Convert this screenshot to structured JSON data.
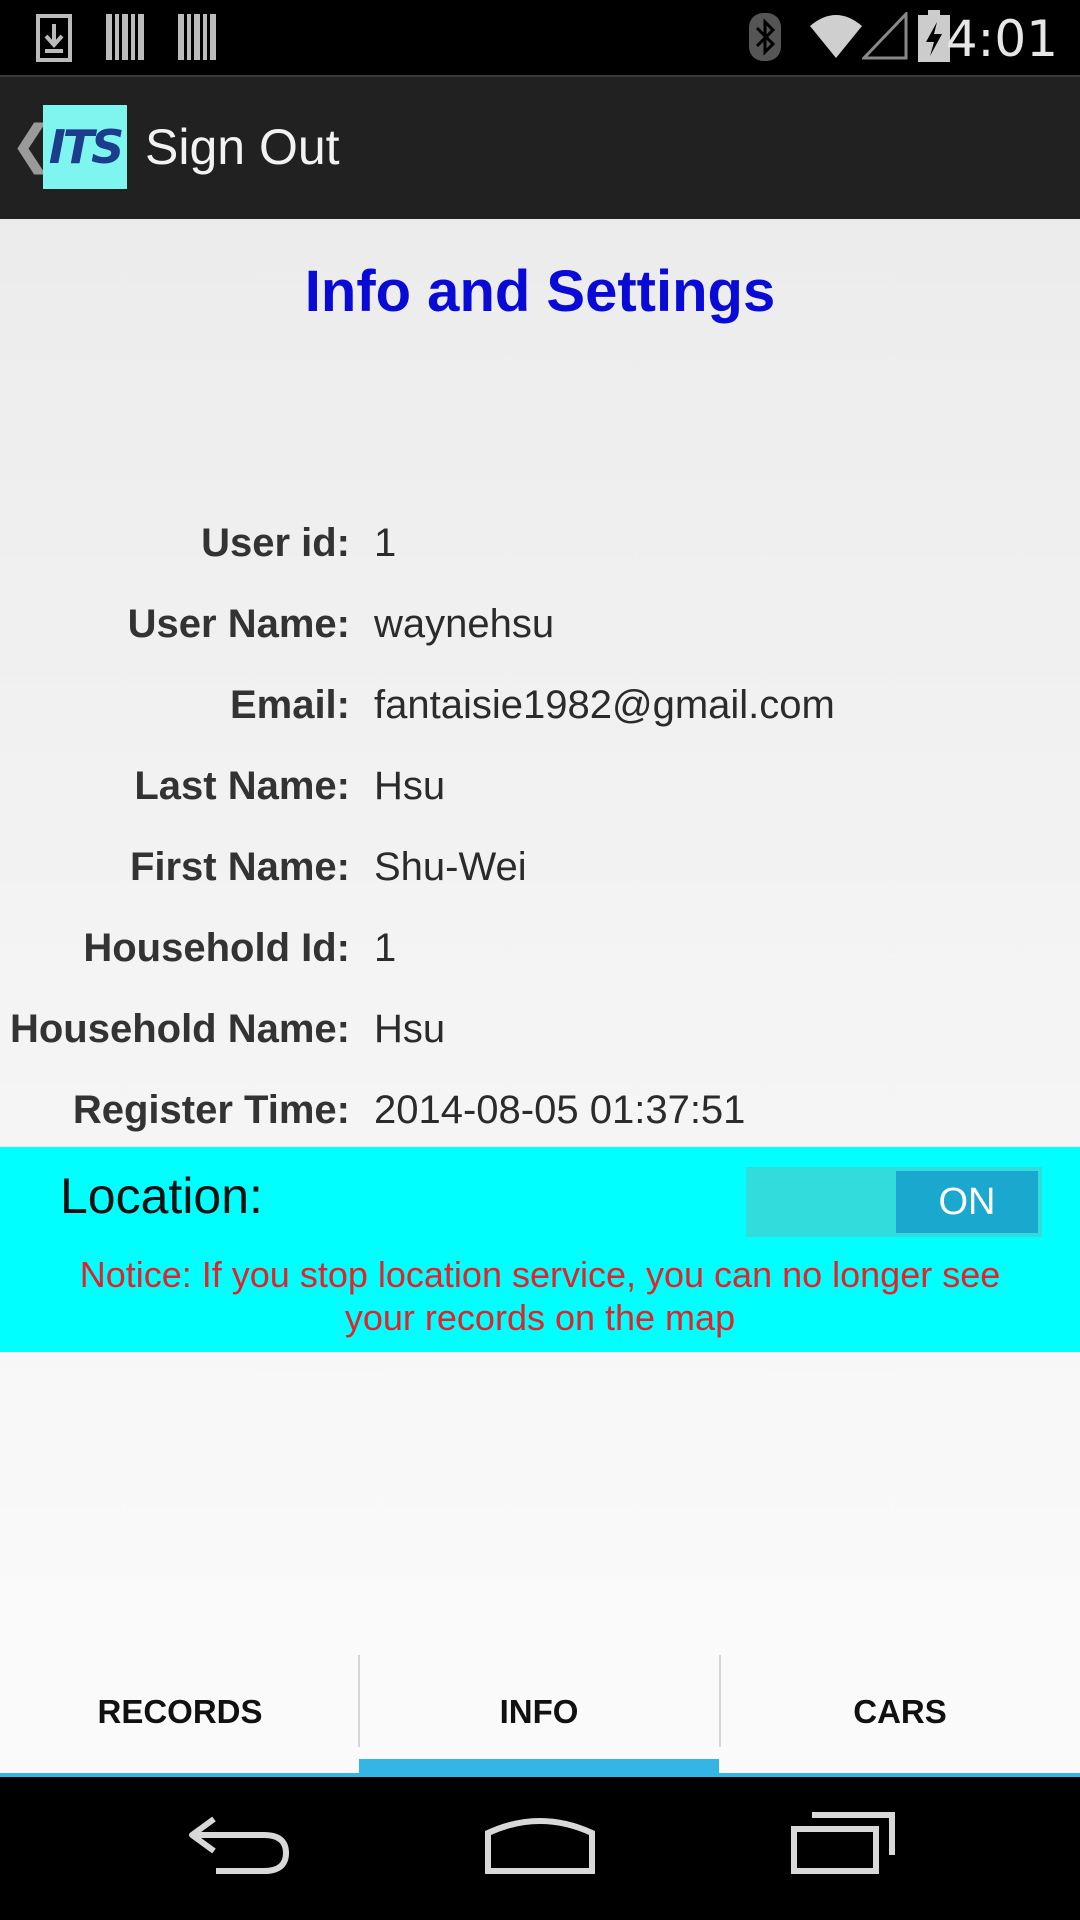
{
  "status_bar": {
    "time": "4:01",
    "icons": [
      "download-notification-icon",
      "barcode-icon",
      "barcode-icon",
      "bluetooth-icon",
      "wifi-icon",
      "cell-signal-icon",
      "battery-charging-icon"
    ]
  },
  "action_bar": {
    "back_glyph": "❮",
    "logo_text": "ITS",
    "title": "Sign Out"
  },
  "page": {
    "title": "Info and Settings",
    "fields": [
      {
        "label": "User id:",
        "value": "1"
      },
      {
        "label": "User Name:",
        "value": "waynehsu"
      },
      {
        "label": "Email:",
        "value": "fantaisie1982@gmail.com"
      },
      {
        "label": "Last Name:",
        "value": "Hsu"
      },
      {
        "label": "First Name:",
        "value": "Shu-Wei"
      },
      {
        "label": "Household Id:",
        "value": "1"
      },
      {
        "label": "Household Name:",
        "value": "Hsu"
      },
      {
        "label": "Register Time:",
        "value": "2014-08-05 01:37:51"
      }
    ]
  },
  "location": {
    "label": "Location:",
    "toggle_state": "ON",
    "notice": "Notice: If you stop location service, you can no longer see your records on the map",
    "panel_color": "#00ffff",
    "notice_color": "#e0242a"
  },
  "tabs": {
    "items": [
      {
        "label": "RECORDS"
      },
      {
        "label": "INFO"
      },
      {
        "label": "CARS"
      }
    ],
    "active": "INFO",
    "accent_color": "#33b5e5"
  },
  "nav_bar": {
    "buttons": [
      "back-icon",
      "home-icon",
      "recent-apps-icon"
    ]
  }
}
